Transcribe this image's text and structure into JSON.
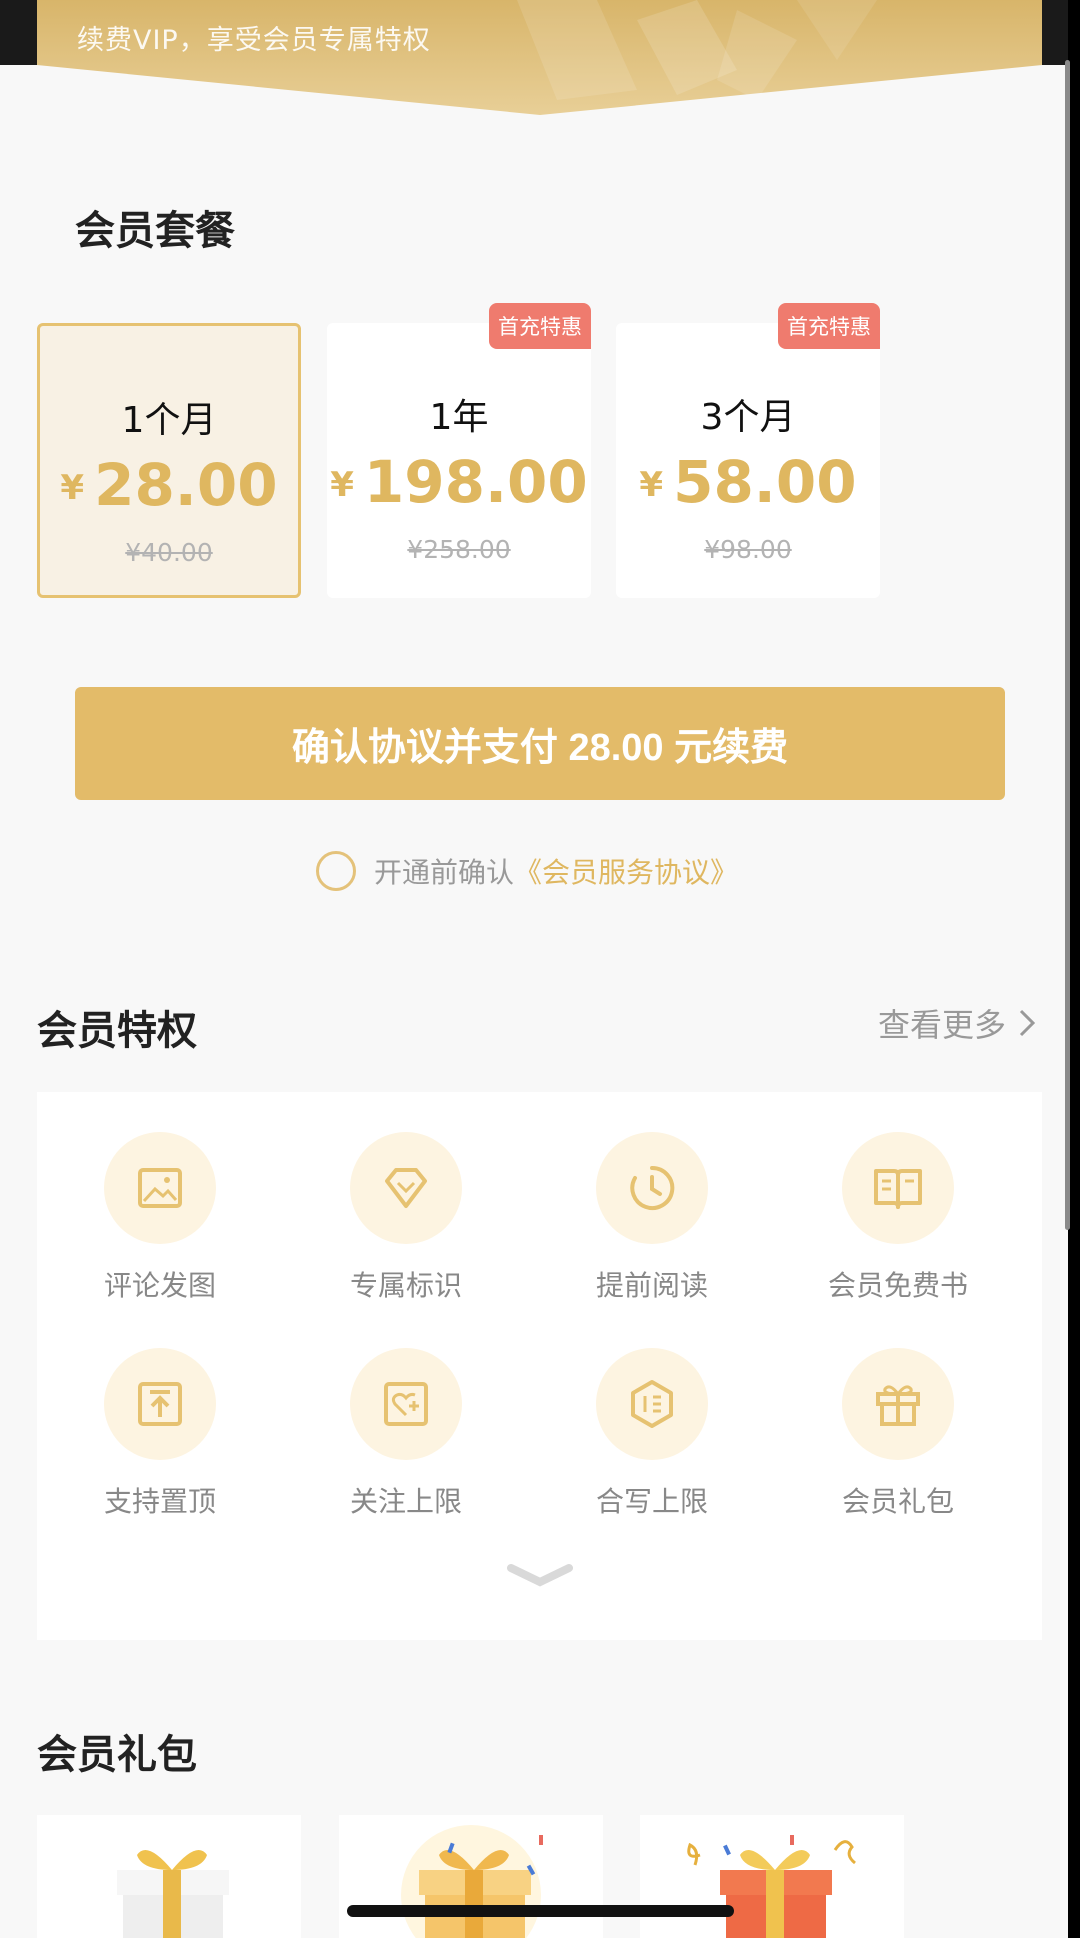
{
  "header": {
    "subtitle": "续费VIP，享受会员专属特权"
  },
  "plans": {
    "section_title": "会员套餐",
    "items": [
      {
        "name": "1个月",
        "currency": "¥",
        "price": "28.00",
        "original": "¥40.00",
        "badge": "",
        "selected": true
      },
      {
        "name": "1年",
        "currency": "¥",
        "price": "198.00",
        "original": "¥258.00",
        "badge": "首充特惠",
        "selected": false
      },
      {
        "name": "3个月",
        "currency": "¥",
        "price": "58.00",
        "original": "¥98.00",
        "badge": "首充特惠",
        "selected": false
      }
    ]
  },
  "payment": {
    "button_label": "确认协议并支付 28.00 元续费",
    "agree_prefix": "开通前确认",
    "agree_link": "《会员服务协议》"
  },
  "privileges": {
    "section_title": "会员特权",
    "see_more": "查看更多",
    "items": [
      {
        "label": "评论发图",
        "icon": "image-icon"
      },
      {
        "label": "专属标识",
        "icon": "diamond-badge-icon"
      },
      {
        "label": "提前阅读",
        "icon": "clock-icon"
      },
      {
        "label": "会员免费书",
        "icon": "book-icon"
      },
      {
        "label": "支持置顶",
        "icon": "pin-top-icon"
      },
      {
        "label": "关注上限",
        "icon": "heart-plus-icon"
      },
      {
        "label": "合写上限",
        "icon": "hexagon-edit-icon"
      },
      {
        "label": "会员礼包",
        "icon": "gift-icon"
      }
    ]
  },
  "gifts": {
    "section_title": "会员礼包"
  },
  "colors": {
    "gold": "#e3bb69",
    "price_gold": "#dfb760",
    "badge_red": "#ef7b6e",
    "icon_bg": "#fdf4e1"
  }
}
